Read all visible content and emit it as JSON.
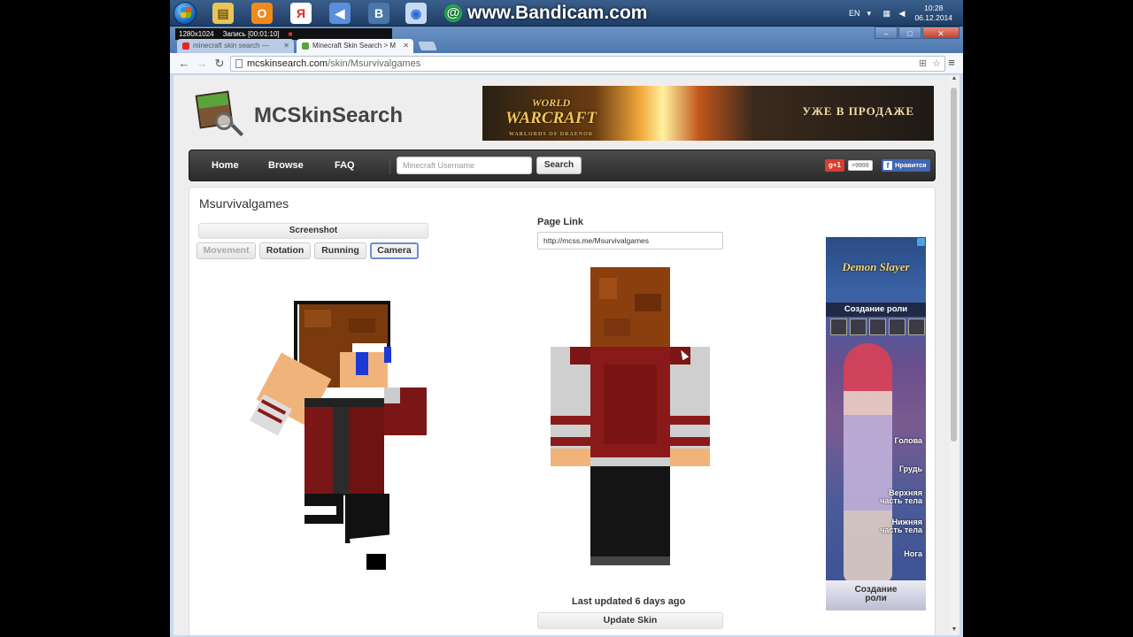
{
  "taskbar": {
    "bandicam_text": "www.Bandicam.com",
    "lang": "EN",
    "time": "10:28",
    "date": "06.12.2014"
  },
  "recorder": {
    "resolution": "1280x1024",
    "status": "Запись [00:01:10]"
  },
  "tabs": [
    {
      "label": "minecraft skin search — ",
      "active": false
    },
    {
      "label": "Minecraft Skin Search > M",
      "active": true
    }
  ],
  "address": {
    "host": "mcskinsearch.com",
    "path": "/skin/Msurvivalgames"
  },
  "site": {
    "logo_text": "MCSkinSearch"
  },
  "banner": {
    "title_line1": "WORLD",
    "title_line2": "WARCRAFT",
    "subtitle": "WARLORDS OF DRAENOR",
    "sale_text": "УЖЕ В ПРОДАЖЕ"
  },
  "nav": {
    "home": "Home",
    "browse": "Browse",
    "faq": "FAQ",
    "search_placeholder": "Minecraft Username",
    "search_button": "Search",
    "gplus": "g+1",
    "gplus_count": ">9999",
    "fb_like": "Нравится"
  },
  "skin": {
    "username": "Msurvivalgames",
    "screenshot_button": "Screenshot",
    "controls": [
      {
        "label": "Movement",
        "state": "disabled"
      },
      {
        "label": "Rotation",
        "state": "normal"
      },
      {
        "label": "Running",
        "state": "normal"
      },
      {
        "label": "Camera",
        "state": "active"
      }
    ],
    "page_link_label": "Page Link",
    "page_link_value": "http://mcss.me/Msurvivalgames",
    "last_updated": "Last updated 6 days ago",
    "update_button": "Update Skin"
  },
  "side_ad": {
    "title": "Demon Slayer",
    "subtitle": "Создание роли",
    "parts": [
      "Голова",
      "Грудь",
      "Верхняя часть тела",
      "Нижняя часть тела",
      "Нога"
    ],
    "cta": "Создание роли"
  },
  "colors": {
    "navbar": "#333333",
    "accent_active": "#6d8fd6",
    "skin_hair": "#8b3f0f",
    "skin_jacket": "#8a1a1a",
    "skin_shirt": "#cfcfcf",
    "skin_pants": "#1a1a1a",
    "skin_face": "#f0b47a",
    "skin_headphones": "#1c38d6"
  }
}
